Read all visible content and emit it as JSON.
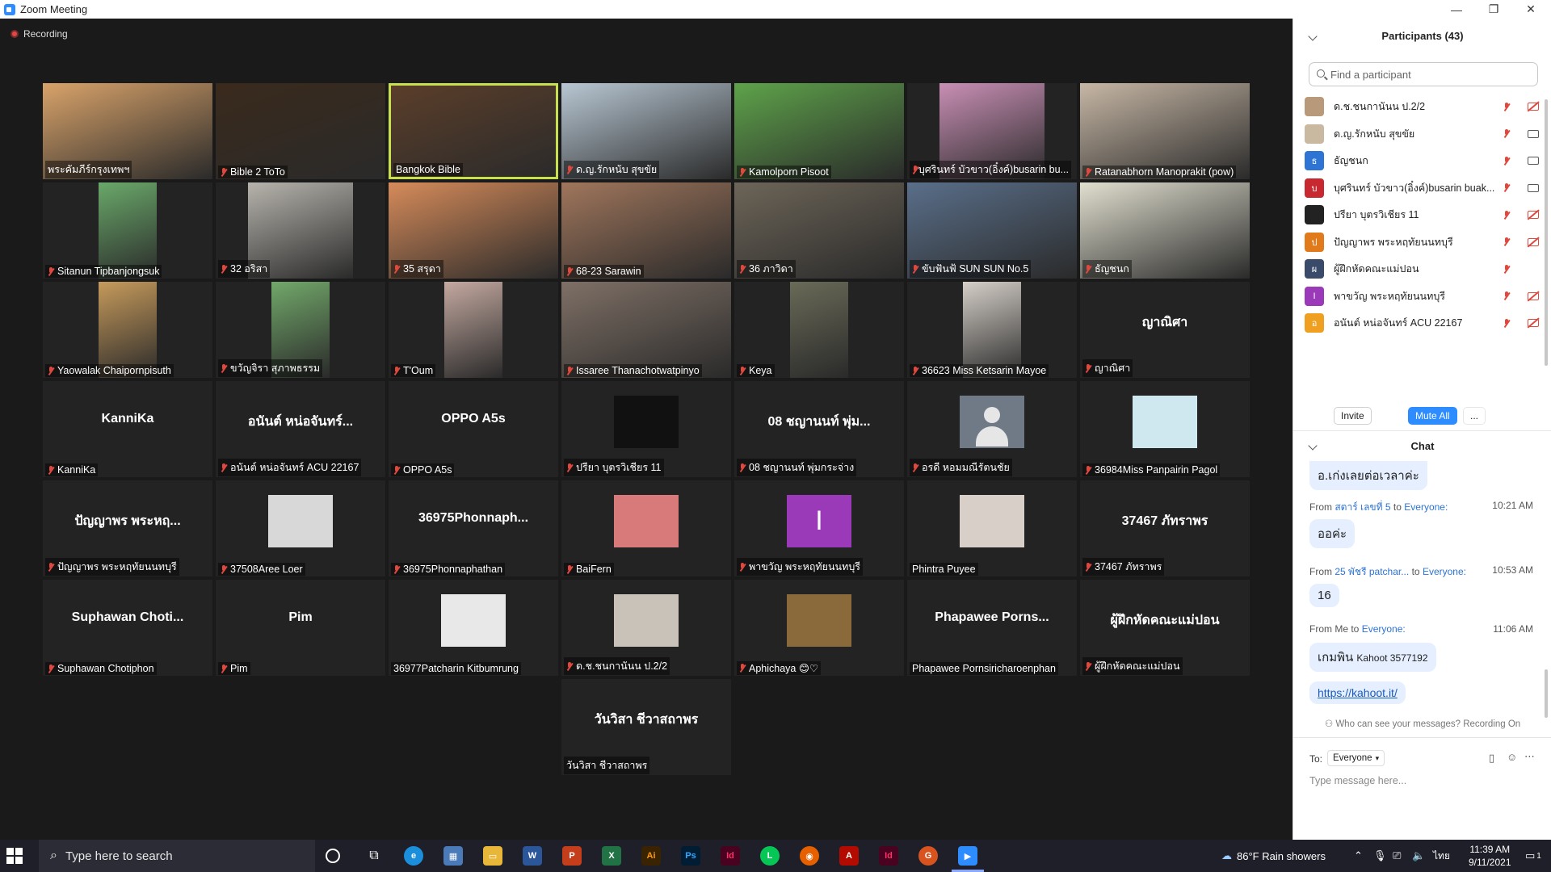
{
  "window": {
    "title": "Zoom Meeting",
    "minimize": "—",
    "restore": "❐",
    "close": "✕"
  },
  "recording": {
    "label": "Recording"
  },
  "tiles": [
    {
      "name": "พระคัมภีร์กรุงเทพฯ",
      "muted": false,
      "video": "#d9a36a"
    },
    {
      "name": "Bible 2 ToTo",
      "muted": true,
      "video": "#3a2a1c"
    },
    {
      "name": "Bangkok Bible",
      "muted": false,
      "video": "#5b3e2a",
      "active": true
    },
    {
      "name": "ด.ญ.รักหนับ สุขขัย",
      "muted": true,
      "video": "#b8c7d3"
    },
    {
      "name": "Kamolporn Pisoot",
      "muted": true,
      "video": "#5ea34a"
    },
    {
      "name": "บุศรินทร์ บัวขาว(อิ๋งค์)busarin bu...",
      "muted": true,
      "video": "#c98fb5",
      "vw": 130
    },
    {
      "name": "Ratanabhorn Manoprakit (pow)",
      "muted": true,
      "video": "#c7b7a5"
    },
    {
      "name": "Sitanun Tipbanjongsuk",
      "muted": true,
      "video": "#6aa86a",
      "vw": 72
    },
    {
      "name": "32 อริสา",
      "muted": true,
      "video": "#b7b4ad",
      "vw": 130
    },
    {
      "name": "35 สรุดา",
      "muted": true,
      "video": "#d68b5a"
    },
    {
      "name": "68-23 Sarawin",
      "muted": true,
      "video": "#a0765c"
    },
    {
      "name": "36 ภาวิดา",
      "muted": true,
      "video": "#6d6558"
    },
    {
      "name": "ขับฟันฟ้ SUN SUN No.5",
      "muted": true,
      "video": "#5a6f8a"
    },
    {
      "name": "ธัญชนก",
      "muted": true,
      "video": "#e1dfcf"
    },
    {
      "name": "Yaowalak Chaipornpisuth",
      "muted": true,
      "video": "#c69a5b",
      "vw": 72
    },
    {
      "name": "ขวัญจิรา สุภาพธรรม",
      "muted": true,
      "video": "#72a86a",
      "vw": 72
    },
    {
      "name": "T'Oum",
      "muted": true,
      "video": "#c4a9a0",
      "vw": 72
    },
    {
      "name": "Issaree Thanachotwatpinyo",
      "muted": true,
      "video": "#7f7066"
    },
    {
      "name": "Keya",
      "muted": true,
      "video": "#6a6a58",
      "vw": 72
    },
    {
      "name": "36623 Miss Ketsarin Mayoe",
      "muted": true,
      "video": "#d5cfc8",
      "vw": 72
    },
    {
      "name": "ญาณิศา",
      "muted": true,
      "big": "ญาณิศา"
    },
    {
      "name": "KanniKa",
      "muted": true,
      "big": "KanniKa"
    },
    {
      "name": "อนันต์ หน่อจันทร์ ACU 22167",
      "muted": true,
      "big": "อนันต์ หน่อจันทร์..."
    },
    {
      "name": "OPPO A5s",
      "muted": true,
      "big": "OPPO A5s"
    },
    {
      "name": "ปรียา บุตรวิเชียร 11",
      "muted": true,
      "avatar": "#111111"
    },
    {
      "name": "08 ชญานนท์ พุ่มกระจ่าง",
      "muted": true,
      "big": "08 ชญานนท์ พุ่ม..."
    },
    {
      "name": "อรดี หอมมณีรัตนชัย",
      "muted": true,
      "placeholder": true
    },
    {
      "name": "36984Miss Panpairin Pagol",
      "muted": true,
      "avatar": "#cfe7ee"
    },
    {
      "name": "ปัญญาพร พระหฤทัยนนทบุรี",
      "muted": true,
      "big": "ปัญญาพร พระหฤ..."
    },
    {
      "name": "37508Aree Loer",
      "muted": true,
      "avatar": "#d8d8d8"
    },
    {
      "name": "36975Phonnaphathan",
      "muted": true,
      "big": "36975Phonnaph..."
    },
    {
      "name": "BaiFern",
      "muted": true,
      "avatar": "#d97a7a"
    },
    {
      "name": "พาขวัญ พระหฤทัยนนทบุรี",
      "muted": true,
      "letter": "I"
    },
    {
      "name": "Phintra Puyee",
      "muted": false,
      "avatar": "#d8d0c8"
    },
    {
      "name": "37467 ภัทราพร",
      "muted": true,
      "big": "37467 ภัทราพร"
    },
    {
      "name": "Suphawan Chotiphon",
      "muted": true,
      "big": "Suphawan Choti..."
    },
    {
      "name": "Pim",
      "muted": true,
      "big": "Pim"
    },
    {
      "name": "36977Patcharin Kitbumrung",
      "muted": false,
      "avatar": "#e8e8e8"
    },
    {
      "name": "ด.ช.ชนกานันน ป.2/2",
      "muted": true,
      "avatar": "#c9c2b8"
    },
    {
      "name": "Aphichaya 😊♡",
      "muted": true,
      "avatar": "#8a6a3a"
    },
    {
      "name": "Phapawee Pornsiricharoenphan",
      "muted": false,
      "big": "Phapawee Porns..."
    },
    {
      "name": "ผู้ฝึกหัดคณะแม่ปอน",
      "muted": true,
      "big": "ผู้ฝึกหัดคณะแม่ปอน"
    },
    {
      "name": "วันวิสา ชีวาสถาพร",
      "muted": false,
      "big": "วันวิสา ชีวาสถาพร"
    }
  ],
  "participants": {
    "title": "Participants (43)",
    "search_placeholder": "Find a participant",
    "rows": [
      {
        "name": "ด.ช.ชนกานันน ป.2/2",
        "color": "#b89a7a",
        "initial": "",
        "cam": "off"
      },
      {
        "name": "ด.ญ.รักหนับ สุขขัย",
        "color": "#c9b9a0",
        "initial": "",
        "cam": "on"
      },
      {
        "name": "ธัญชนก",
        "color": "#2d74d4",
        "initial": "ธ",
        "cam": "on"
      },
      {
        "name": "บุศรินทร์ บัวขาว(อิ๋งค์)busarin buak...",
        "color": "#c8282f",
        "initial": "บ",
        "cam": "on"
      },
      {
        "name": "ปรียา บุตรวิเชียร  11",
        "color": "#222222",
        "initial": "",
        "cam": "off"
      },
      {
        "name": "ปัญญาพร พระหฤทัยนนทบุรี",
        "color": "#e07a1a",
        "initial": "ป",
        "cam": "off"
      },
      {
        "name": "ผู้ฝึกหัดคณะแม่ปอน",
        "color": "#3a4a6a",
        "initial": "ผ",
        "cam": "none"
      },
      {
        "name": "พาขวัญ พระหฤทัยนนทบุรี",
        "color": "#9b3ab8",
        "initial": "I",
        "cam": "off"
      },
      {
        "name": "อนันต์ หน่อจันทร์ ACU 22167",
        "color": "#f0a020",
        "initial": "อ",
        "cam": "off"
      }
    ],
    "invite": "Invite",
    "mute_all": "Mute All",
    "more": "..."
  },
  "chat": {
    "title": "Chat",
    "top_bubble": "อ.เก่งเลยต่อเวลาค่ะ",
    "messages": [
      {
        "from": "From",
        "who": "สตาร์ เลขที่ 5",
        "to": "to",
        "target": "Everyone:",
        "time": "10:21 AM",
        "text": "ออค่ะ"
      },
      {
        "from": "From",
        "who": "25 พัชรี patchar...",
        "to": "to",
        "target": "Everyone:",
        "time": "10:53 AM",
        "text": "16"
      },
      {
        "from": "From Me",
        "who": "",
        "to": "to",
        "target": "Everyone:",
        "time": "11:06 AM",
        "text": "เกมพิน",
        "extra": "Kahoot 3577192",
        "link": "https://kahoot.it/"
      }
    ],
    "notice": "Who can see your messages? Recording On",
    "to_label": "To:",
    "to_value": "Everyone",
    "placeholder": "Type message here..."
  },
  "taskbar": {
    "search_placeholder": "Type here to search",
    "weather": "86°F  Rain showers",
    "lang": "ไทย",
    "time": "11:39 AM",
    "date": "9/11/2021",
    "notif_count": "1"
  }
}
